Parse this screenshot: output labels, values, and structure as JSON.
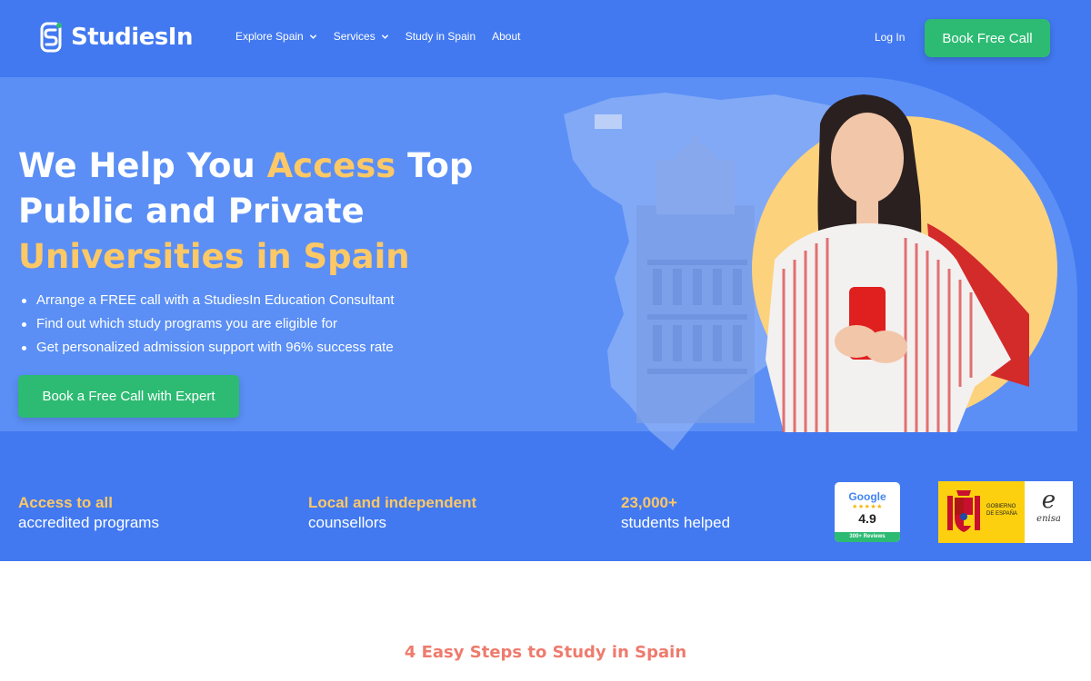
{
  "brand": {
    "name": "StudiesIn"
  },
  "nav": {
    "items": [
      {
        "label": "Explore Spain",
        "has_dropdown": true
      },
      {
        "label": "Services",
        "has_dropdown": true
      },
      {
        "label": "Study in Spain",
        "has_dropdown": false
      },
      {
        "label": "About",
        "has_dropdown": false
      }
    ],
    "login_label": "Log In",
    "book_label": "Book Free Call"
  },
  "hero": {
    "headline_part1": "We Help You ",
    "headline_highlight1": "Access",
    "headline_part2": " Top Public and Private ",
    "headline_highlight2": "Universities in Spain",
    "bullets": [
      "Arrange a FREE call with a StudiesIn Education Consultant",
      "Find out which study programs you are eligible for",
      "Get personalized admission support with 96% success rate"
    ],
    "cta_label": "Book a Free Call with Expert"
  },
  "stats": [
    {
      "top": "Access to all",
      "bottom": "accredited programs"
    },
    {
      "top": "Local and independent",
      "bottom": "counsellors"
    },
    {
      "top": "23,000+",
      "bottom": "students helped"
    }
  ],
  "badges": {
    "google": {
      "name": "Google",
      "stars": "★★★★★",
      "rating": "4.9",
      "reviews": "300+ Reviews"
    },
    "gov": {
      "line1": "GOBIERNO",
      "line2": "DE ESPAÑA",
      "partner": "enisa"
    }
  },
  "steps": {
    "title": "4 Easy Steps to Study in Spain"
  },
  "colors": {
    "primary_bg": "#4279f0",
    "accent": "#fdc866",
    "cta": "#2dbb73",
    "steps_title": "#ee7b6d"
  }
}
